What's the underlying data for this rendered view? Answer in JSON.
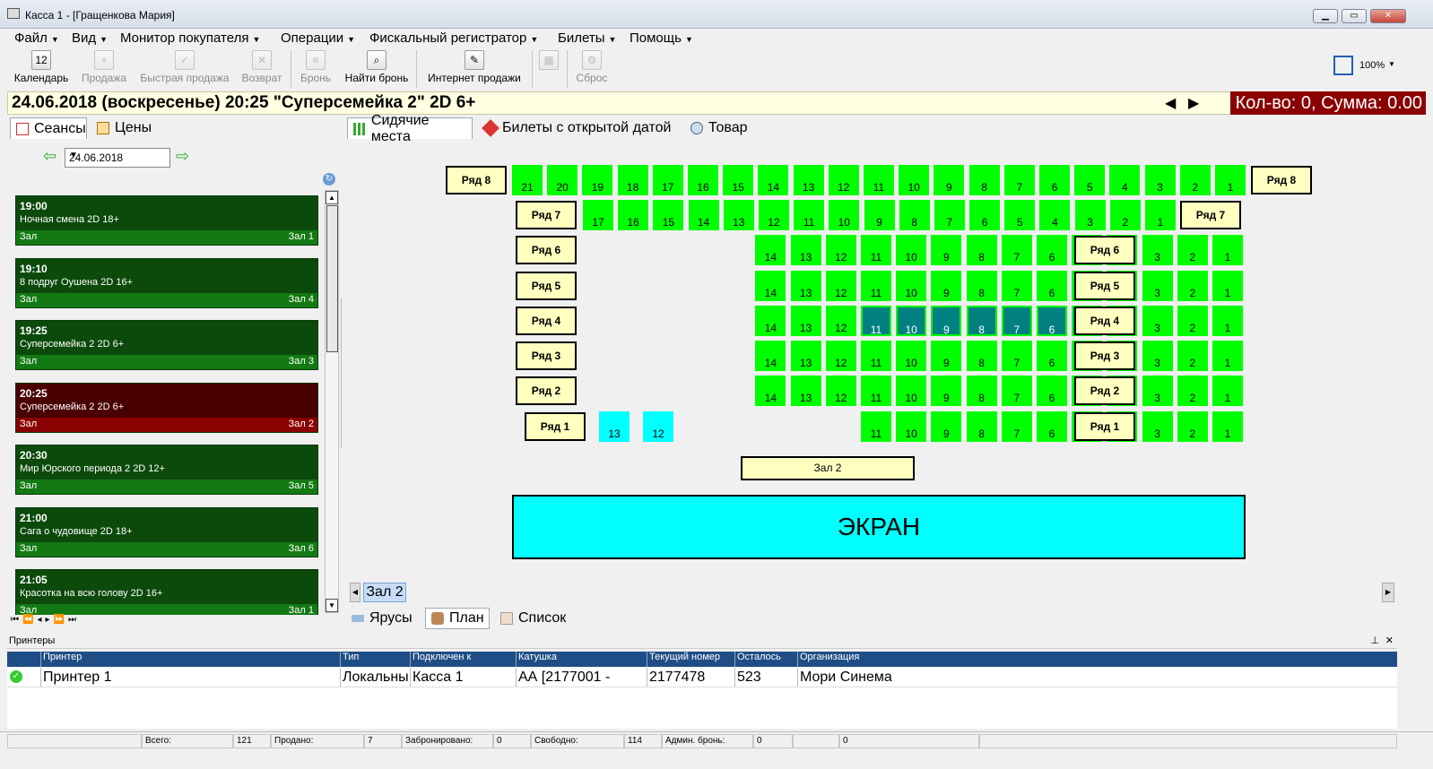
{
  "window": {
    "title": "Касса 1 - [Гращенкова Мария]",
    "minimize": "▁",
    "maximize": "▭",
    "close": "✕"
  },
  "menu": [
    "Файл",
    "Вид",
    "Монитор покупателя",
    "Операции",
    "Фискальный регистратор",
    "Билеты",
    "Помощь"
  ],
  "toolbar": {
    "calendar": "Календарь",
    "sale": "Продажа",
    "quick_sale": "Быстрая продажа",
    "refund": "Возврат",
    "booking": "Бронь",
    "find_booking": "Найти бронь",
    "internet_sales": "Интернет продажи",
    "reset": "Сброс",
    "zoom": "100%"
  },
  "info": {
    "session_title": "24.06.2018  (воскресенье) 20:25  \"Суперсемейка 2\" 2D 6+",
    "summary": "Кол-во: 0, Сумма: 0.00",
    "summary_color": "#8b0000"
  },
  "left_tabs": {
    "sessions": "Сеансы",
    "prices": "Цены"
  },
  "date": {
    "value": "24.06.2018"
  },
  "sessions": [
    {
      "time": "19:00",
      "film": "Ночная смена  2D 18+",
      "hall_label": "Зал",
      "hall": "Зал 1",
      "state": "normal"
    },
    {
      "time": "19:10",
      "film": "8 подруг Оушена  2D 16+",
      "hall_label": "Зал",
      "hall": "Зал 4",
      "state": "normal"
    },
    {
      "time": "19:25",
      "film": "Суперсемейка 2 2D 6+",
      "hall_label": "Зал",
      "hall": "Зал 3",
      "state": "normal"
    },
    {
      "time": "20:25",
      "film": "Суперсемейка 2 2D 6+",
      "hall_label": "Зал",
      "hall": "Зал 2",
      "state": "selected"
    },
    {
      "time": "20:30",
      "film": "Мир Юрского периода 2  2D 12+",
      "hall_label": "Зал",
      "hall": "Зал 5",
      "state": "normal"
    },
    {
      "time": "21:00",
      "film": "Сага о чудовище 2D 18+",
      "hall_label": "Зал",
      "hall": "Зал 6",
      "state": "normal"
    },
    {
      "time": "21:05",
      "film": "Красотка на всю голову  2D 16+",
      "hall_label": "Зал",
      "hall": "Зал 1",
      "state": "normal"
    }
  ],
  "right_tabs": {
    "seats": "Сидячие места",
    "open_date": "Билеты с открытой датой",
    "goods": "Товар"
  },
  "hall": {
    "rows": [
      {
        "label": "Ряд 8",
        "seats": [
          21,
          20,
          19,
          18,
          17,
          16,
          15,
          14,
          13,
          12,
          11,
          10,
          9,
          8,
          7,
          6,
          5,
          4,
          3,
          2,
          1
        ],
        "sold": [],
        "booked": []
      },
      {
        "label": "Ряд 7",
        "seats": [
          17,
          16,
          15,
          14,
          13,
          12,
          11,
          10,
          9,
          8,
          7,
          6,
          5,
          4,
          3,
          2,
          1
        ],
        "sold": [],
        "booked": []
      },
      {
        "label": "Ряд 6",
        "seats": [
          14,
          13,
          12,
          11,
          10,
          9,
          8,
          7,
          6,
          5,
          4,
          3,
          2,
          1
        ],
        "sold": [],
        "booked": []
      },
      {
        "label": "Ряд 5",
        "seats": [
          14,
          13,
          12,
          11,
          10,
          9,
          8,
          7,
          6,
          5,
          4,
          3,
          2,
          1
        ],
        "sold": [],
        "booked": []
      },
      {
        "label": "Ряд 4",
        "seats": [
          14,
          13,
          12,
          11,
          10,
          9,
          8,
          7,
          6,
          5,
          4,
          3,
          2,
          1
        ],
        "sold": [
          11,
          10,
          9,
          8,
          7,
          6,
          5
        ],
        "booked": []
      },
      {
        "label": "Ряд 3",
        "seats": [
          14,
          13,
          12,
          11,
          10,
          9,
          8,
          7,
          6,
          5,
          4,
          3,
          2,
          1
        ],
        "sold": [],
        "booked": []
      },
      {
        "label": "Ряд 2",
        "seats": [
          14,
          13,
          12,
          11,
          10,
          9,
          8,
          7,
          6,
          5,
          4,
          3,
          2,
          1
        ],
        "sold": [],
        "booked": []
      },
      {
        "label": "Ряд 1",
        "seats": [
          13,
          12,
          11,
          10,
          9,
          8,
          7,
          6,
          5,
          4,
          3,
          2,
          1
        ],
        "sold": [],
        "booked": [
          13,
          12
        ]
      }
    ],
    "name": "Зал 2",
    "screen": "ЭКРАН",
    "colors": {
      "free": "#00ff00",
      "sold": "#008080",
      "booked": "#00ffff"
    }
  },
  "hall_tab": "Зал 2",
  "view_tabs": {
    "tiers": "Ярусы",
    "plan": "План",
    "list": "Список"
  },
  "printers": {
    "panel_title": "Принтеры",
    "columns": [
      "Принтер",
      "Тип",
      "Подключен к",
      "Катушка",
      "Текущий номер",
      "Осталось",
      "Организация"
    ],
    "row": [
      "Принтер 1",
      "Локальны",
      "Касса 1",
      "АА [2177001 -",
      "2177478",
      "523",
      "Мори Синема"
    ]
  },
  "status": {
    "total_label": "Всего:",
    "total": "121",
    "sold_label": "Продано:",
    "sold": "7",
    "booked_label": "Забронировано:",
    "booked": "0",
    "free_label": "Свободно:",
    "free": "114",
    "admin_label": "Админ. бронь:",
    "admin": "0",
    "extra": "0"
  }
}
